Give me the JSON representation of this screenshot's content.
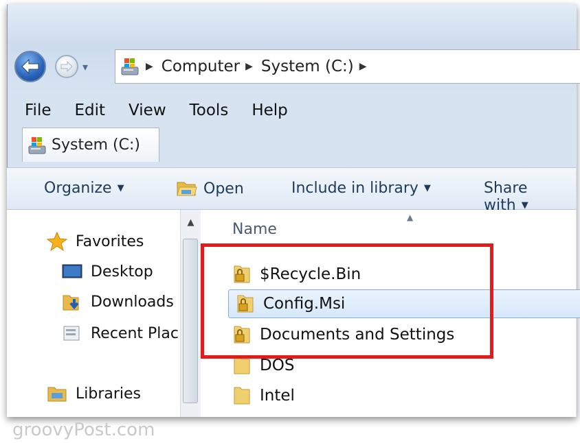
{
  "address": {
    "crumbs": [
      "Computer",
      "System (C:)"
    ]
  },
  "menu": [
    "File",
    "Edit",
    "View",
    "Tools",
    "Help"
  ],
  "tab": {
    "label": "System (C:)"
  },
  "toolbar": {
    "organize": "Organize",
    "open": "Open",
    "include": "Include in library",
    "share": "Share with"
  },
  "nav_pane": {
    "favorites": "Favorites",
    "desktop": "Desktop",
    "downloads": "Downloads",
    "recent": "Recent Plac",
    "libraries": "Libraries"
  },
  "content": {
    "column_name": "Name",
    "rows": [
      "$Recycle.Bin",
      "Config.Msi",
      "Documents and Settings",
      "DOS",
      "Intel"
    ]
  },
  "watermark": "groovyPost.com",
  "colors": {
    "highlight": "#e21b1b",
    "selection": "#d6e8fb"
  }
}
